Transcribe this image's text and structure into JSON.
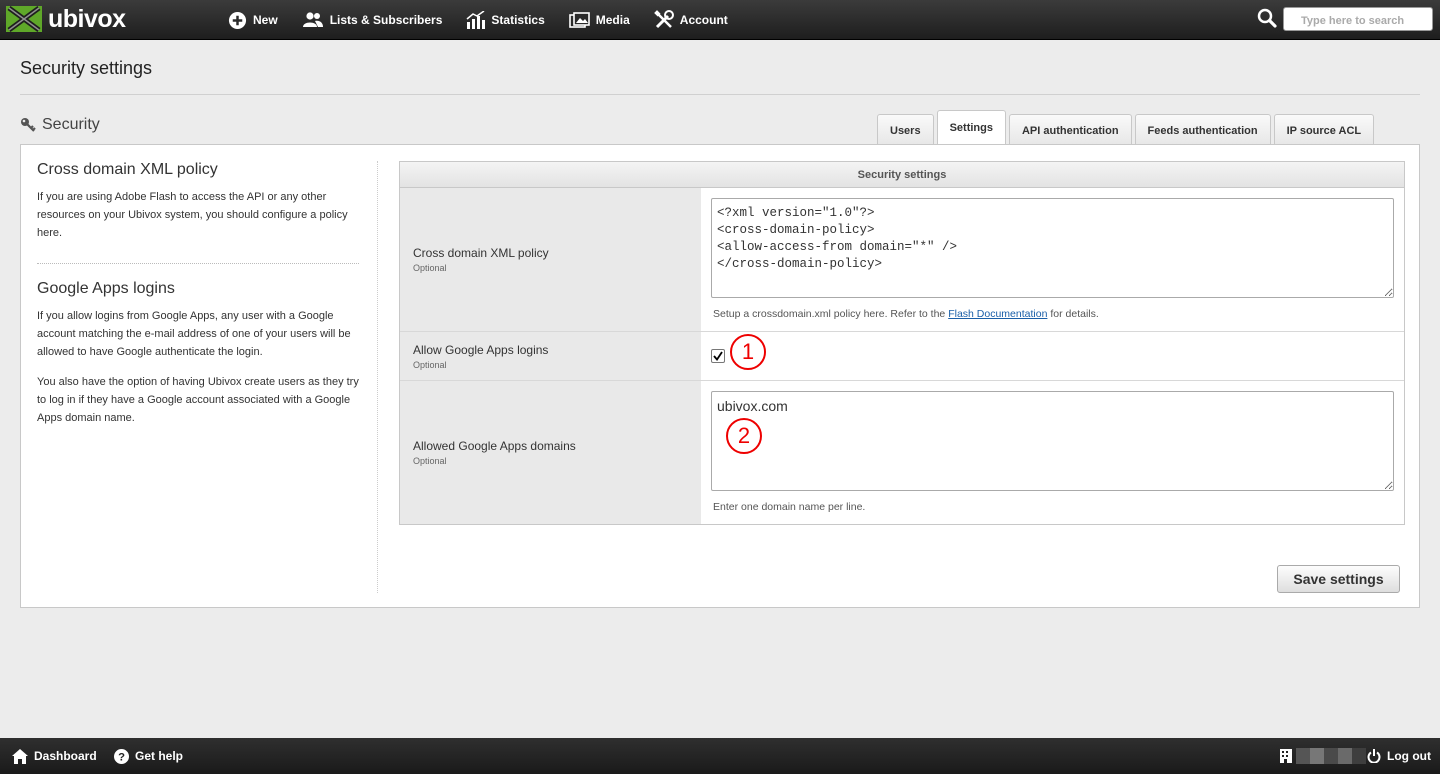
{
  "app": {
    "name": "ubivox"
  },
  "nav": {
    "items": [
      {
        "label": "New",
        "icon": "plus-circle-icon"
      },
      {
        "label": "Lists & Subscribers",
        "icon": "users-icon"
      },
      {
        "label": "Statistics",
        "icon": "bar-chart-icon"
      },
      {
        "label": "Media",
        "icon": "images-icon"
      },
      {
        "label": "Account",
        "icon": "tools-icon"
      }
    ],
    "search_placeholder": "Type here to search"
  },
  "page": {
    "title": "Security settings"
  },
  "section": {
    "title": "Security",
    "icon": "key-icon"
  },
  "tabs": [
    {
      "label": "Users",
      "active": false
    },
    {
      "label": "Settings",
      "active": true
    },
    {
      "label": "API authentication",
      "active": false
    },
    {
      "label": "Feeds authentication",
      "active": false
    },
    {
      "label": "IP source ACL",
      "active": false
    }
  ],
  "sidebar": {
    "xml_title": "Cross domain XML policy",
    "xml_text": "If you are using Adobe Flash to access the API or any other resources on your Ubivox system, you should configure a policy here.",
    "google_title": "Google Apps logins",
    "google_text1": "If you allow logins from Google Apps, any user with a Google account matching the e-mail address of one of your users will be allowed to have Google authenticate the login.",
    "google_text2": "You also have the option of having Ubivox create users as they try to log in if they have a Google account associated with a Google Apps domain name."
  },
  "settings": {
    "header": "Security settings",
    "xml_policy": {
      "label": "Cross domain XML policy",
      "optional": "Optional",
      "value": "<?xml version=\"1.0\"?>\n<cross-domain-policy>\n<allow-access-from domain=\"*\" />\n</cross-domain-policy>",
      "hint_before": "Setup a crossdomain.xml policy here. Refer to the ",
      "hint_link": "Flash Documentation",
      "hint_after": " for details."
    },
    "allow_google": {
      "label": "Allow Google Apps logins",
      "optional": "Optional",
      "checked": true
    },
    "google_domains": {
      "label": "Allowed Google Apps domains",
      "optional": "Optional",
      "value": "ubivox.com",
      "hint": "Enter one domain name per line."
    }
  },
  "callouts": [
    "1",
    "2"
  ],
  "save_label": "Save settings",
  "footer": {
    "dashboard": "Dashboard",
    "help": "Get help",
    "logout": "Log out"
  },
  "colors": {
    "brand_green": "#5fa829",
    "callout_red": "#e00000",
    "link_blue": "#1a5fa8"
  }
}
